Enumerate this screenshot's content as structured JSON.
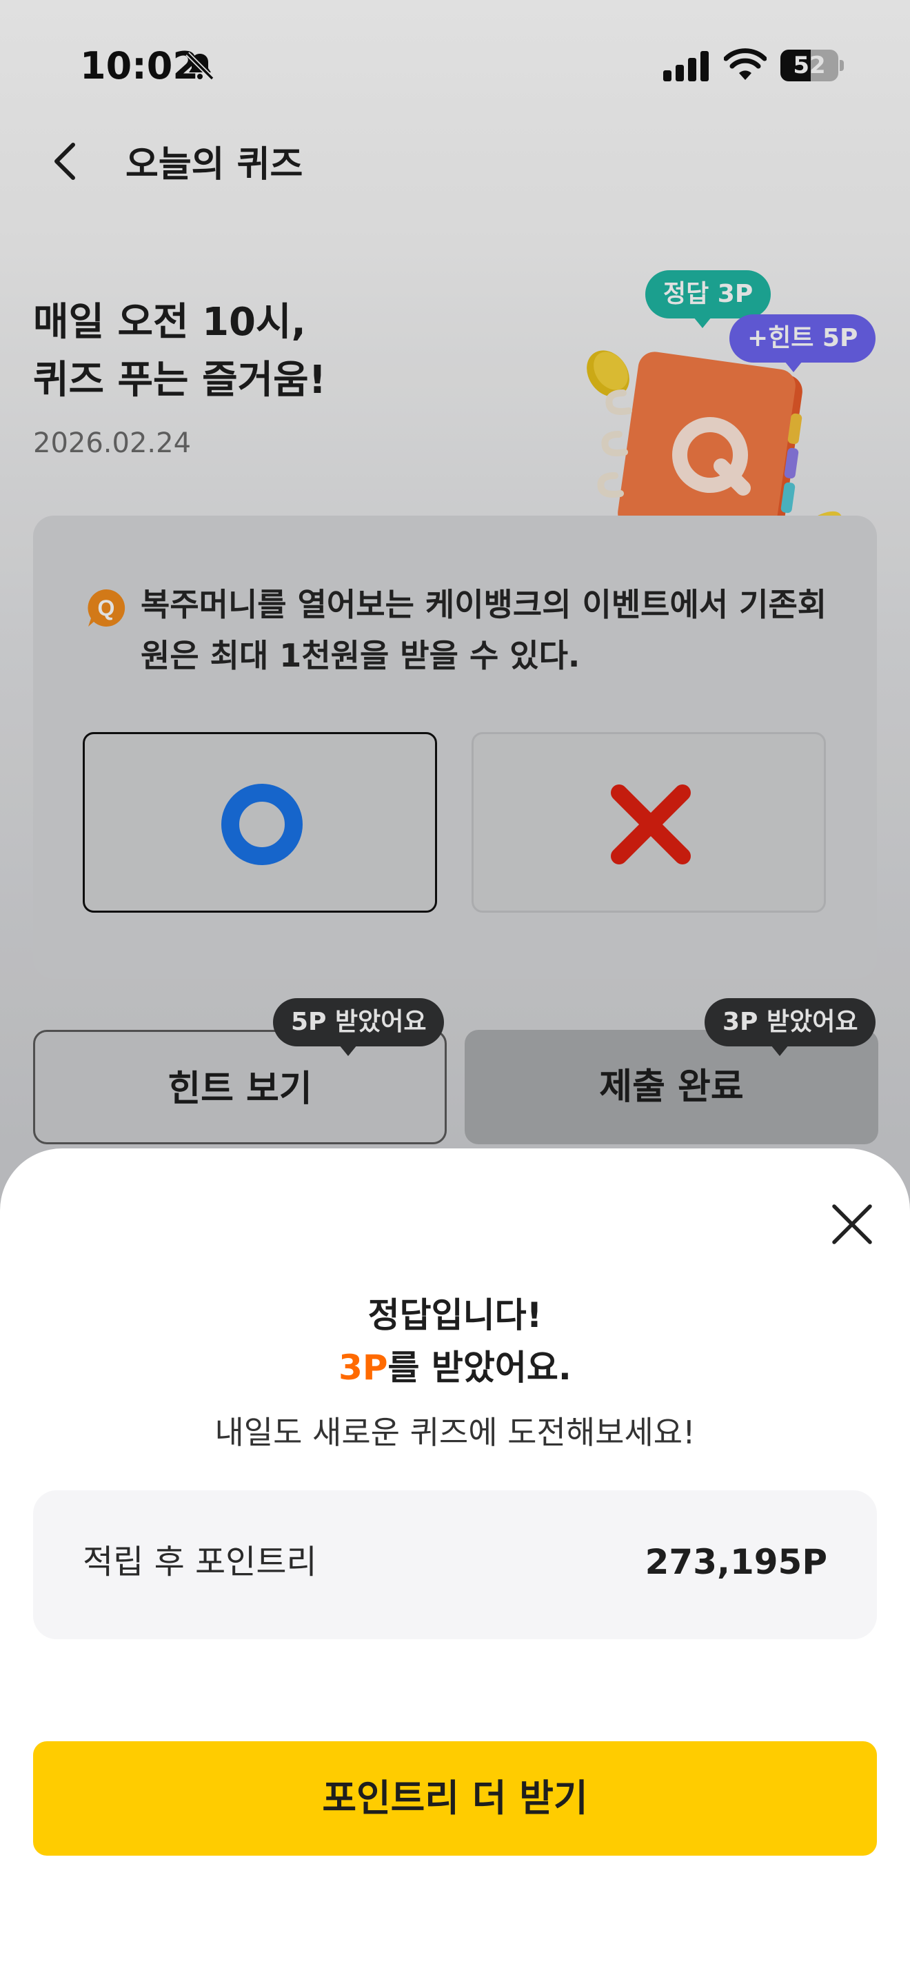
{
  "status_bar": {
    "time": "10:02",
    "battery_level": "52",
    "battery_fraction": 0.52,
    "icons": [
      "bell-slash-icon",
      "signal-icon",
      "wifi-icon",
      "battery-icon"
    ]
  },
  "nav": {
    "back_icon": "chevron-left-icon",
    "title": "오늘의 퀴즈"
  },
  "hero": {
    "title_line1": "매일 오전 10시,",
    "title_line2": "퀴즈 푸는 즐거움!",
    "date": "2026.02.24",
    "badge_correct": "정답 3P",
    "badge_hint": "+힌트 5P"
  },
  "quiz": {
    "q_badge": "Q",
    "question": "복주머니를 열어보는 케이뱅크의 이벤트에서 기존회원은 최대 1천원을 받을 수 있다.",
    "options": [
      {
        "icon": "circle-o-icon",
        "selected": true
      },
      {
        "icon": "x-mark-icon",
        "selected": false
      }
    ]
  },
  "actions": {
    "hint_label": "힌트 보기",
    "hint_chip": "5P 받았어요",
    "submit_label": "제출 완료",
    "submit_chip": "3P 받았어요"
  },
  "result": {
    "title": "정답입니다!",
    "points": "3P",
    "points_suffix": "를 받았어요.",
    "description": "내일도 새로운 퀴즈에 도전해보세요!",
    "total_label": "적립 후 포인트리",
    "total_value": "273,195P",
    "cta_label": "포인트리 더 받기"
  },
  "colors": {
    "accent_yellow": "#ffcc00",
    "accent_orange": "#ff6a00",
    "o_blue": "#1a73e8",
    "x_red": "#e02010",
    "badge_teal": "#1fb6a2",
    "badge_purple": "#6c63ee"
  }
}
